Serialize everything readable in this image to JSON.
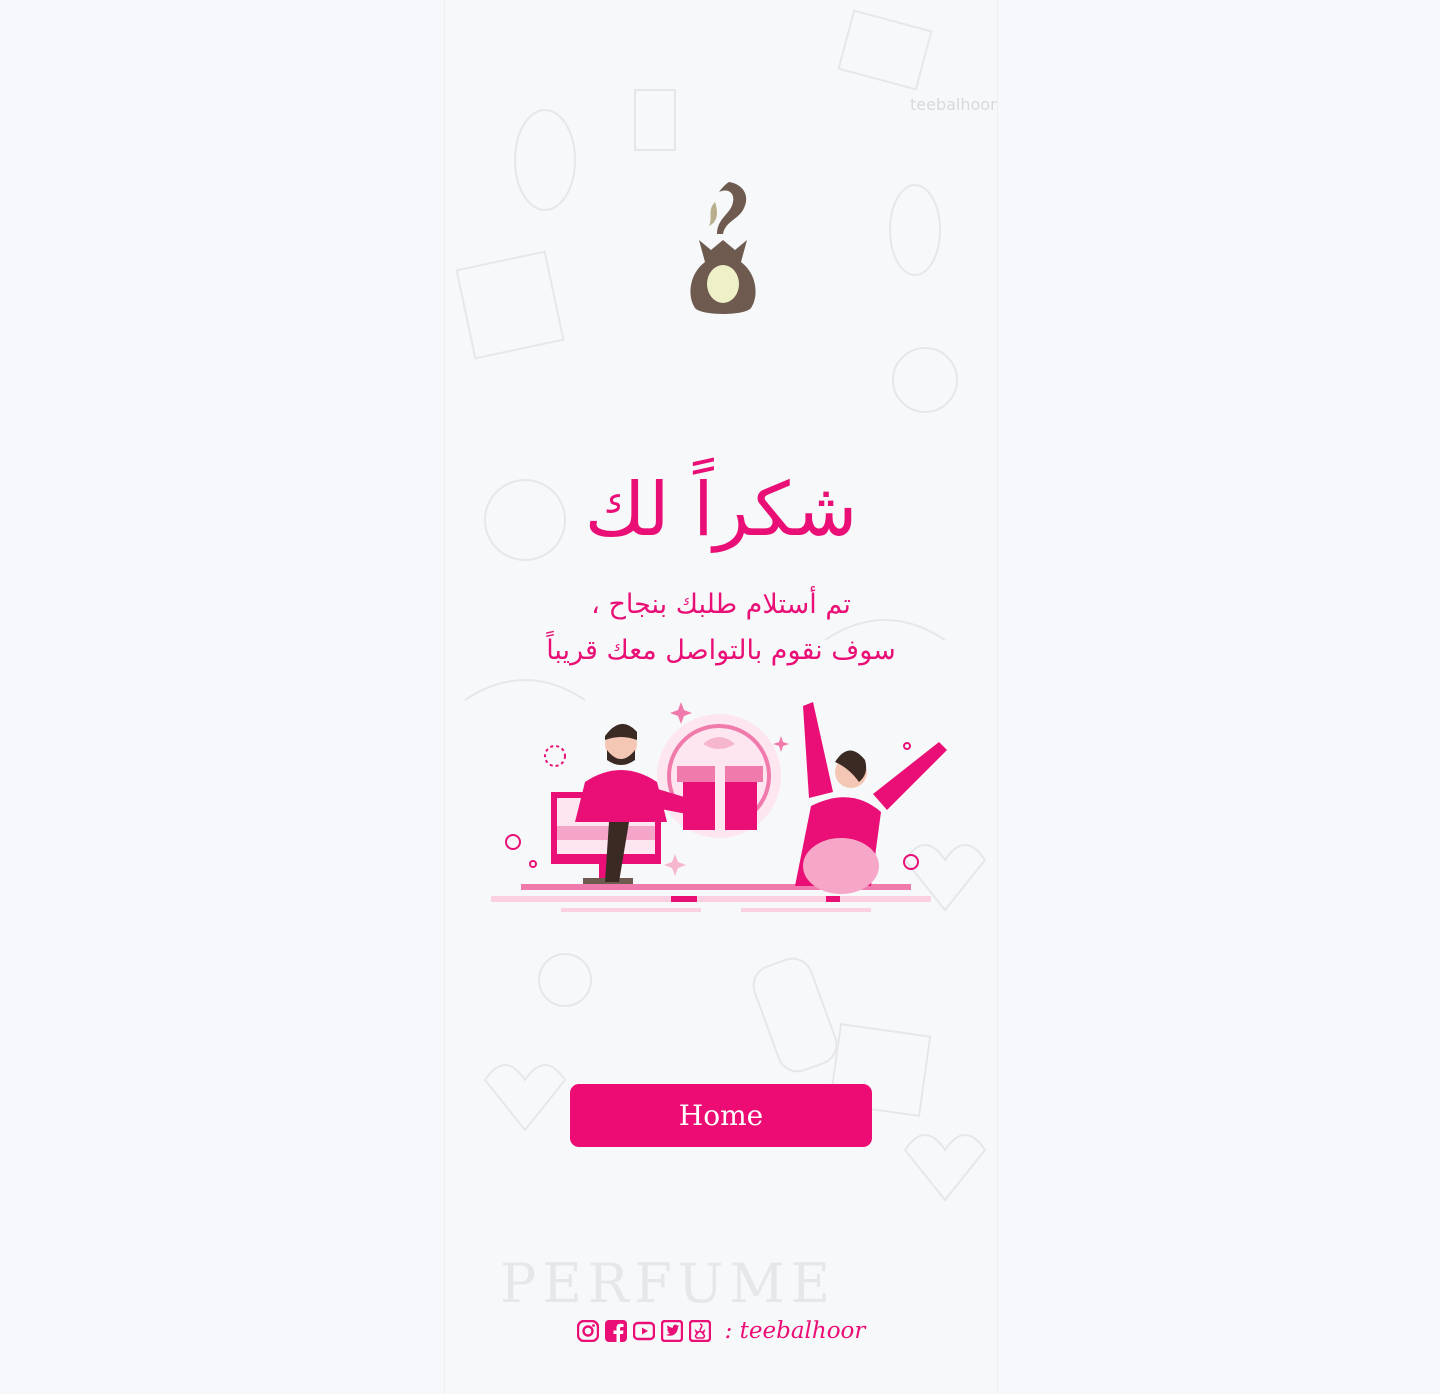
{
  "brand": {
    "accent": "#e90f76",
    "button_color": "#ec0c74",
    "logo_color": "#6e5a4f",
    "logo_icon": "perfume-burner-logo"
  },
  "thank_you": {
    "title": "شكراً لك",
    "line1": "تم أستلام طلبك بنجاح ،",
    "line2": "سوف نقوم بالتواصل معك قريباً"
  },
  "illustration": {
    "icon": "gift-delivery-illustration"
  },
  "actions": {
    "home_label": "Home"
  },
  "footer": {
    "handle": ": teebalhoor",
    "socials": [
      "instagram-icon",
      "facebook-icon",
      "youtube-icon",
      "twitter-icon",
      "teebalhoor-icon"
    ]
  }
}
